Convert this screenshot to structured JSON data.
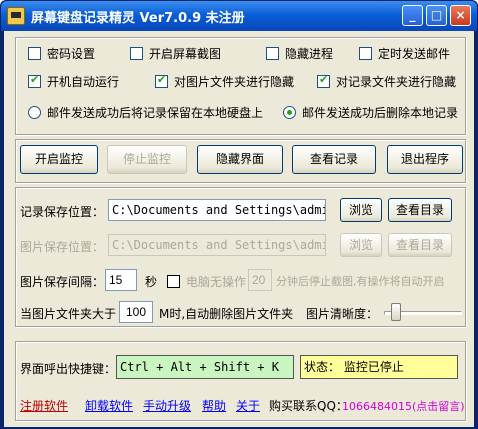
{
  "window": {
    "title": "屏幕键盘记录精灵  Ver7.0.9   未注册",
    "buttons": {
      "minimize": "_",
      "maximize": "□",
      "close": "×"
    }
  },
  "options": {
    "password_setting": {
      "label": "密码设置",
      "checked": false
    },
    "screen_capture": {
      "label": "开启屏幕截图",
      "checked": false
    },
    "hide_process": {
      "label": "隐藏进程",
      "checked": false
    },
    "scheduled_email": {
      "label": "定时发送邮件",
      "checked": false
    },
    "auto_start": {
      "label": "开机自动运行",
      "checked": true
    },
    "hide_image_folder": {
      "label": "对图片文件夹进行隐藏",
      "checked": true
    },
    "hide_record_folder": {
      "label": "对记录文件夹进行隐藏",
      "checked": true
    },
    "keep_records_radio": {
      "label": "邮件发送成功后将记录保留在本地硬盘上",
      "selected": false
    },
    "delete_records_radio": {
      "label": "邮件发送成功后删除本地记录",
      "selected": true
    }
  },
  "actions": {
    "start": "开启监控",
    "stop": "停止监控",
    "hide": "隐藏界面",
    "view": "查看记录",
    "exit": "退出程序"
  },
  "storage": {
    "record_label": "记录保存位置：",
    "record_path": "C:\\Documents and Settings\\admin",
    "browse": "浏览",
    "view_dir": "查看目录",
    "image_label": "图片保存位置：",
    "image_path": "C:\\Documents and Settings\\admin",
    "interval_label": "图片保存间隔：",
    "interval_value": "15",
    "seconds": "秒",
    "idle_label": "电脑无操作",
    "idle_value": "20",
    "idle_suffix": "分钟后停止截图,有操作将自动开启",
    "folder_prefix": "当图片文件夹大于",
    "folder_value": "100",
    "folder_suffix": "M时,自动删除图片文件夹",
    "clarity_label": "图片清晰度：",
    "clarity_level": 0.1
  },
  "footer": {
    "hotkey_label": "界面呼出快捷键：",
    "hotkey_value": "Ctrl + Alt + Shift + K",
    "status_text": "状态：  监控已停止",
    "links": [
      "注册软件",
      "卸载软件",
      "手动升级",
      "帮助",
      "关于"
    ],
    "contact_label": "购买联系QQ：",
    "contact_value": "1066484015(点击留言)"
  },
  "colors": {
    "hotkey_bg": "#c8f5c0",
    "status_bg": "#ffff99",
    "link": "#0000ff",
    "register_link": "#c00000",
    "contact": "#d400d4"
  }
}
